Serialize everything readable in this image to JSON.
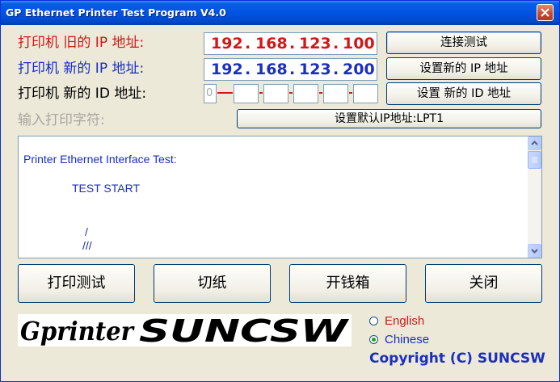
{
  "window": {
    "title": "GP Ethernet Printer Test Program  V4.0"
  },
  "form": {
    "old_ip_label": "打印机 旧的 IP 地址:",
    "new_ip_label": "打印机 新的 IP 地址:",
    "new_id_label": "打印机 新的 ID 地址:",
    "input_chars_label": "输入打印字符:",
    "old_ip": [
      "192",
      "168",
      "123",
      "100"
    ],
    "new_ip": [
      "192",
      "168",
      "123",
      "200"
    ],
    "new_id": [
      "0",
      "",
      "",
      "",
      "",
      ""
    ]
  },
  "buttons": {
    "connect_test": "连接测试",
    "set_new_ip": "设置新的 IP 地址",
    "set_new_id": "设置 新的 ID 地址",
    "set_default_ip": "设置默认IP地址:LPT1",
    "print_test": "打印测试",
    "cut_paper": "切纸",
    "open_drawer": "开钱箱",
    "close": "关闭"
  },
  "output": {
    "lines": [
      "Printer Ethernet Interface Test:",
      "TEST  START",
      "/",
      "///"
    ]
  },
  "logo": {
    "text": "GprinterSUNCSW"
  },
  "language": {
    "options": [
      "English",
      "Chinese"
    ],
    "selected": "Chinese"
  },
  "copyright": "Copyright (C) SUNCSW",
  "colors": {
    "red_label": "#d01818",
    "blue_label": "#1a2fbf",
    "disabled_label": "#a8a6a0",
    "title_bar": "#0054e3",
    "radio_dot": "#21a121"
  }
}
